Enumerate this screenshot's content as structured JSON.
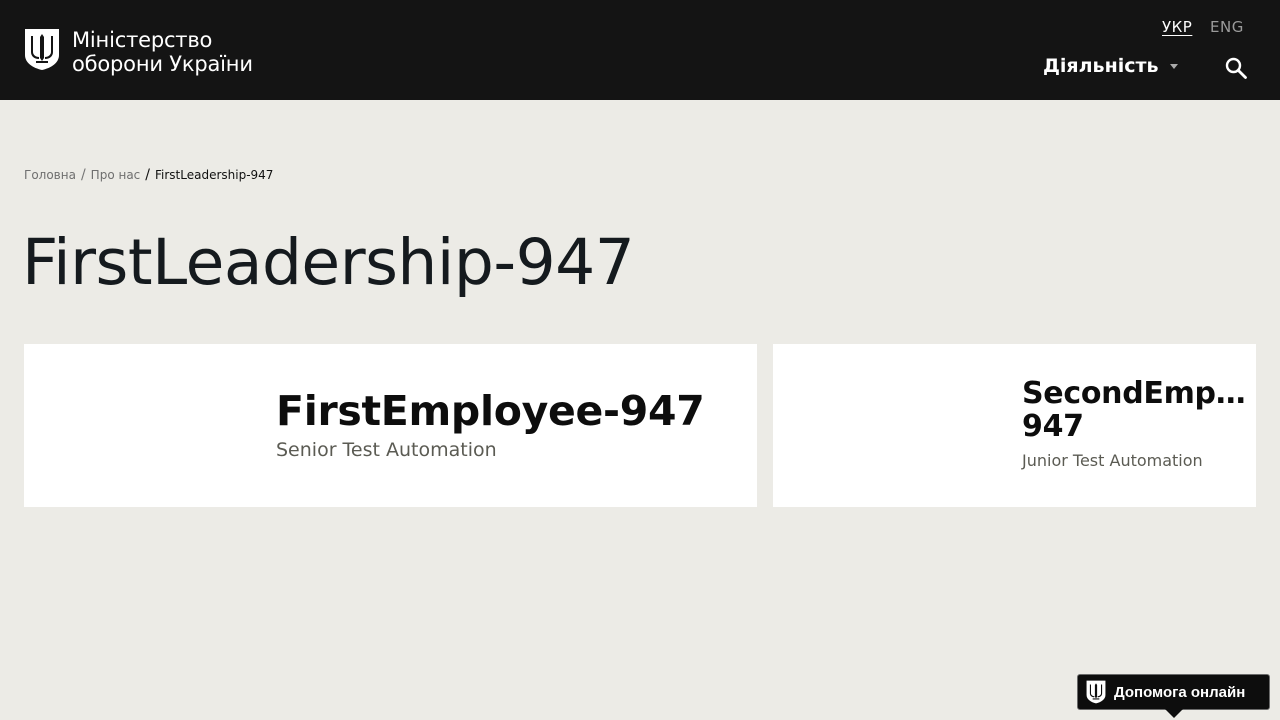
{
  "header": {
    "logo_line1": "Міністерство",
    "logo_line2": "оборони України",
    "lang_ukr": "УКР",
    "lang_eng": "ENG",
    "menu_label": "Діяльність",
    "search_icon": "search-icon",
    "logo_icon": "trident-shield-icon"
  },
  "breadcrumb": {
    "home": "Головна",
    "about": "Про нас",
    "current": "FirstLeadership-947",
    "separator": "/"
  },
  "page": {
    "title": "FirstLeadership-947"
  },
  "cards": [
    {
      "name": "FirstEmployee-947",
      "role": "Senior Test Automation"
    },
    {
      "name_line1": "SecondEmployee-",
      "name_line2": "947",
      "role": "Junior Test Automation"
    }
  ],
  "help": {
    "label": "Допомога онлайн",
    "icon": "trident-shield-icon"
  },
  "colors": {
    "header_bg": "#141414",
    "page_bg": "#ecebe6",
    "card_bg": "#ffffff",
    "role_text": "#5b5b53"
  }
}
